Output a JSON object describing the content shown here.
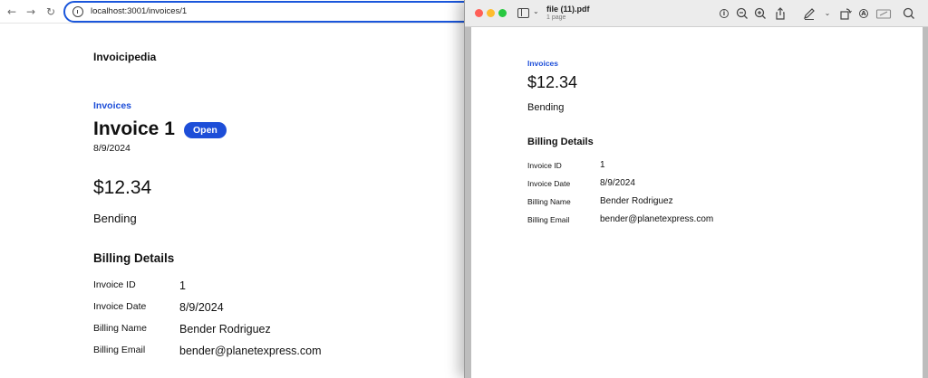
{
  "browser": {
    "url": "localhost:3001/invoices/1"
  },
  "app": {
    "site_title": "Invoicipedia",
    "breadcrumb": "Invoices",
    "invoice_title": "Invoice 1",
    "status_badge": "Open",
    "invoice_date": "8/9/2024",
    "amount": "$12.34",
    "description": "Bending",
    "billing_heading": "Billing Details",
    "billing": [
      {
        "label": "Invoice ID",
        "value": "1"
      },
      {
        "label": "Invoice Date",
        "value": "8/9/2024"
      },
      {
        "label": "Billing Name",
        "value": "Bender Rodriguez"
      },
      {
        "label": "Billing Email",
        "value": "bender@planetexpress.com"
      }
    ]
  },
  "preview": {
    "file_name": "file (11).pdf",
    "page_count": "1 page",
    "toolbar_icons": [
      "info-icon",
      "zoom-out-icon",
      "zoom-in-icon",
      "share-icon",
      "markup-pen-icon",
      "markup-menu-chevron-icon",
      "rotate-icon",
      "annotate-icon",
      "form-fill-icon",
      "search-icon"
    ],
    "pdf": {
      "breadcrumb": "Invoices",
      "amount": "$12.34",
      "description": "Bending",
      "billing_heading": "Billing Details",
      "billing": [
        {
          "label": "Invoice ID",
          "value": "1"
        },
        {
          "label": "Invoice Date",
          "value": "8/9/2024"
        },
        {
          "label": "Billing Name",
          "value": "Bender Rodriguez"
        },
        {
          "label": "Billing Email",
          "value": "bender@planetexpress.com"
        }
      ]
    }
  },
  "colors": {
    "accent": "#1d4ed8",
    "traffic_red": "#ff5f57",
    "traffic_yellow": "#febc2e",
    "traffic_green": "#28c840"
  }
}
